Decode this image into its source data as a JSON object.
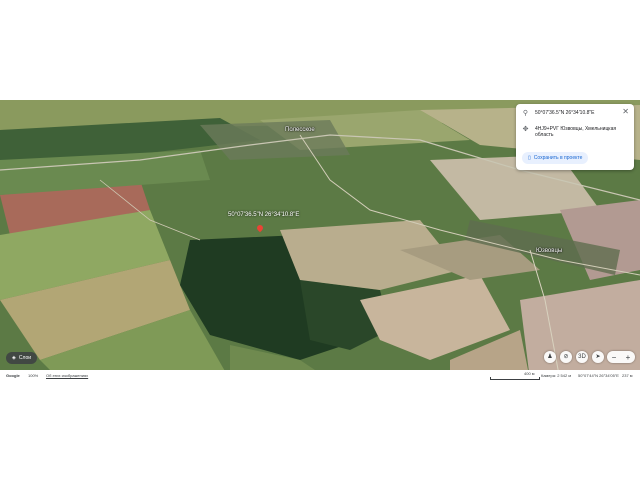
{
  "map": {
    "labels": {
      "village_top": "Полесское",
      "village_right": "Юзвовцы",
      "pin_coords": "50°07'36.5\"N 26°34'10.8\"E"
    }
  },
  "info_card": {
    "coords": "50°07'36.5\"N 26°34'10.8\"E",
    "plus_code": "4HJ9+PVГ Юзвовцы, Хмельницкая область",
    "save_label": "Сохранить в проекте",
    "icons": {
      "location": "location-pin-icon",
      "plus_code": "plus-code-icon",
      "close": "close-icon",
      "bookmark": "bookmark-icon"
    }
  },
  "controls": {
    "layers_label": "Слои",
    "view_3d_label": "3D",
    "zoom_out": "−",
    "zoom_in": "+"
  },
  "footer": {
    "brand": "Google",
    "zoom_percent": "100%",
    "view_images": "Об этих изображениях",
    "scale": "400 м",
    "camera": "Камера: 2 542 м",
    "cursor": "50°07'44\"N 26°34'05\"E",
    "elevation": "237 м"
  },
  "colors": {
    "pin": "#ea4335",
    "save_button_bg": "#e8f0fe",
    "save_button_text": "#1967d2"
  }
}
